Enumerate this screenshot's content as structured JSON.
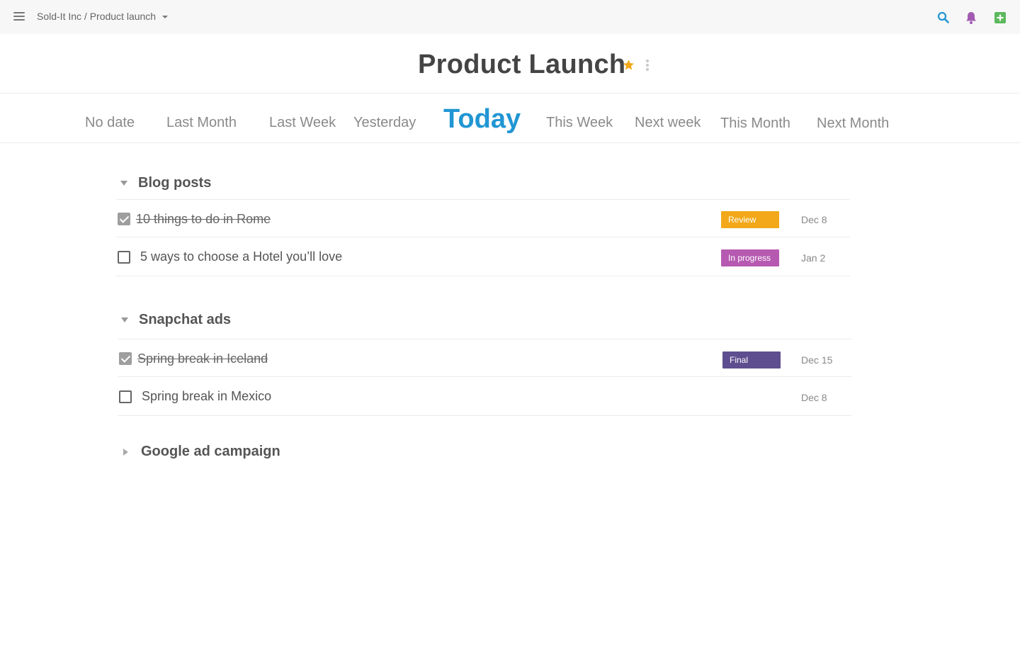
{
  "topbar": {
    "breadcrumb": "Sold-It Inc / Product launch",
    "icons": [
      "menu-icon",
      "search-icon",
      "bell-icon",
      "add-icon"
    ],
    "colors": {
      "search": "#2196d3",
      "bell": "#a25bb1",
      "add": "#5cb85c"
    }
  },
  "title": "Product Launch",
  "tabs": [
    {
      "label": "No date"
    },
    {
      "label": "Last Month"
    },
    {
      "label": "Last Week"
    },
    {
      "label": "Yesterday"
    },
    {
      "label": "Today",
      "active": true
    },
    {
      "label": "This Week"
    },
    {
      "label": "Next week"
    },
    {
      "label": "This Month"
    },
    {
      "label": "Next Month"
    }
  ],
  "groups": [
    {
      "name": "Blog posts",
      "expanded": true,
      "tasks": [
        {
          "text": "10 things to do in Rome",
          "done": true,
          "status": "Review",
          "status_color": "#f2a818",
          "due": "Dec 8"
        },
        {
          "text": "5 ways to choose a Hotel you’ll love",
          "done": false,
          "status": "In progress",
          "status_color": "#b65ab1",
          "due": "Jan 2"
        }
      ]
    },
    {
      "name": "Snapchat ads",
      "expanded": true,
      "tasks": [
        {
          "text": "Spring break in Iceland",
          "done": true,
          "status": "Final",
          "status_color": "#5e4e8f",
          "due": "Dec 15"
        },
        {
          "text": "Spring break in Mexico",
          "done": false,
          "status": "",
          "due": "Dec 8"
        }
      ]
    },
    {
      "name": "Google ad campaign",
      "expanded": false,
      "tasks": []
    }
  ]
}
